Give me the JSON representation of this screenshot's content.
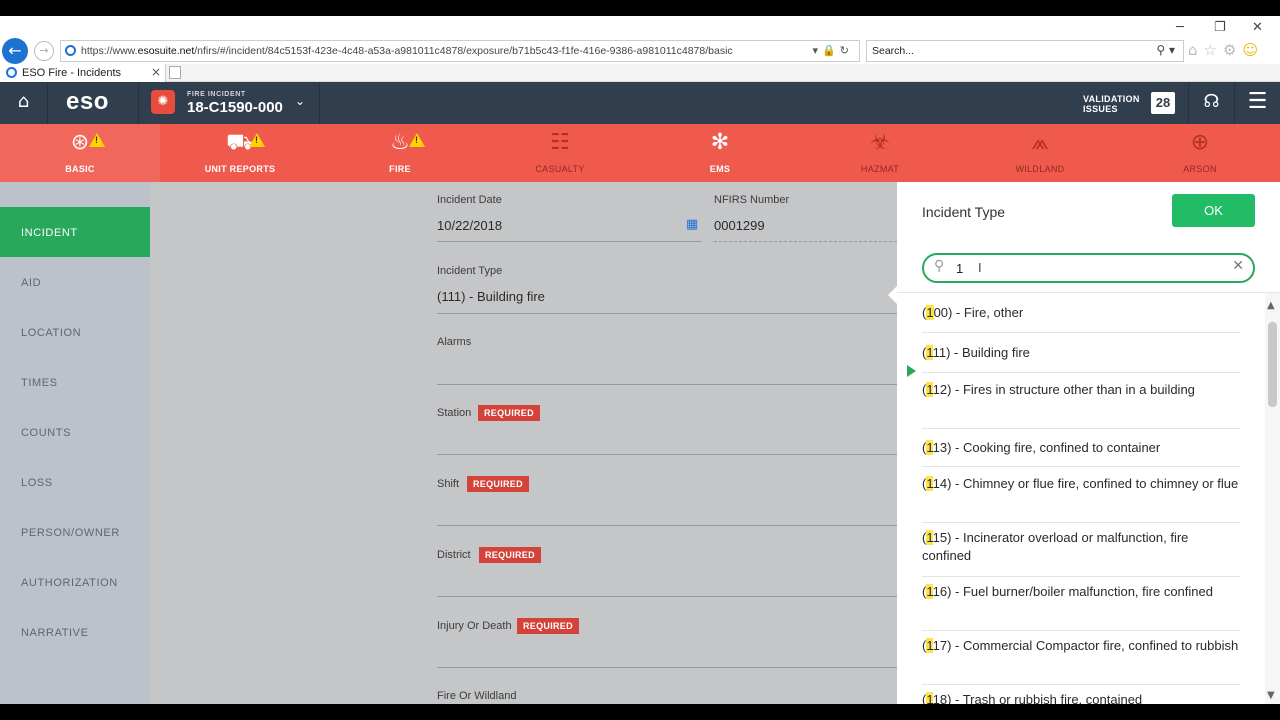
{
  "browser": {
    "url_prefix": "https://www.",
    "url_domain": "esosuite.net",
    "url_rest": "/nfirs/#/incident/84c5153f-423e-4c48-a53a-a981011c4878/exposure/b71b5c43-f1fe-416e-9386-a981011c4878/basic",
    "search_placeholder": "Search...",
    "tab_title": "ESO Fire - Incidents"
  },
  "header": {
    "logo": "eso",
    "incident_label": "FIRE INCIDENT",
    "incident_number": "18-C1590-000",
    "validation_label_1": "VALIDATION",
    "validation_label_2": "ISSUES",
    "validation_count": "28"
  },
  "modules": [
    {
      "label": "BASIC",
      "icon": "life-ring-icon",
      "warning": true,
      "active": true
    },
    {
      "label": "UNIT REPORTS",
      "icon": "fire-truck-icon",
      "warning": true,
      "active": false
    },
    {
      "label": "FIRE",
      "icon": "flame-icon",
      "warning": true,
      "active": false
    },
    {
      "label": "CASUALTY",
      "icon": "stretcher-icon",
      "warning": false,
      "active": false
    },
    {
      "label": "EMS",
      "icon": "star-of-life-icon",
      "warning": false,
      "active": false
    },
    {
      "label": "HAZMAT",
      "icon": "biohazard-icon",
      "warning": false,
      "active": false
    },
    {
      "label": "WILDLAND",
      "icon": "wildland-fire-icon",
      "warning": false,
      "active": false
    },
    {
      "label": "ARSON",
      "icon": "evidence-bag-icon",
      "warning": false,
      "active": false
    }
  ],
  "sidebar": {
    "items": [
      {
        "label": "INCIDENT",
        "active": true
      },
      {
        "label": "AID"
      },
      {
        "label": "LOCATION"
      },
      {
        "label": "TIMES"
      },
      {
        "label": "COUNTS"
      },
      {
        "label": "LOSS"
      },
      {
        "label": "PERSON/OWNER"
      },
      {
        "label": "AUTHORIZATION"
      },
      {
        "label": "NARRATIVE"
      }
    ]
  },
  "form": {
    "incident_date_label": "Incident Date",
    "incident_date_value": "10/22/2018",
    "nfirs_label": "NFIRS Number",
    "nfirs_value": "0001299",
    "incident_type_label": "Incident Type",
    "incident_type_value": "(111) - Building fire",
    "alarms_label": "Alarms",
    "station_label": "Station",
    "shift_label": "Shift",
    "district_label": "District",
    "injury_label": "Injury Or Death",
    "fire_wildland_label": "Fire Or Wildland",
    "required_badge": "REQUIRED"
  },
  "panel": {
    "title": "Incident Type",
    "ok_label": "OK",
    "search_value": "1",
    "options": [
      {
        "pre": "(",
        "hl": "1",
        "post": "00) - Fire, other"
      },
      {
        "pre": "(",
        "hl": "1",
        "post": "11) - Building fire",
        "selected": true
      },
      {
        "pre": "(",
        "hl": "1",
        "post": "12) - Fires in structure other than in a building"
      },
      {
        "pre": "(",
        "hl": "1",
        "post": "13) - Cooking fire, confined to container"
      },
      {
        "pre": "(",
        "hl": "1",
        "post": "14) - Chimney or flue fire, confined to chimney or flue"
      },
      {
        "pre": "(",
        "hl": "1",
        "post": "15) - Incinerator overload or malfunction, fire confined"
      },
      {
        "pre": "(",
        "hl": "1",
        "post": "16) - Fuel burner/boiler malfunction, fire confined"
      },
      {
        "pre": "(",
        "hl": "1",
        "post": "17) - Commercial Compactor fire, confined to rubbish"
      },
      {
        "pre": "(",
        "hl": "1",
        "post": "18) - Trash or rubbish fire, contained"
      }
    ]
  }
}
